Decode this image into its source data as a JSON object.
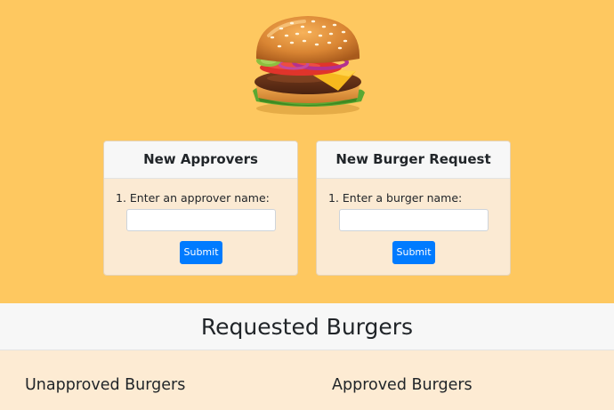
{
  "hero": {
    "image_icon": "burger-icon"
  },
  "forms": {
    "approvers": {
      "title": "New Approvers",
      "label": "1. Enter an approver name:",
      "input_value": "",
      "submit_label": "Submit"
    },
    "burger_request": {
      "title": "New Burger Request",
      "label": "1. Enter a burger name:",
      "input_value": "",
      "submit_label": "Submit"
    }
  },
  "requested": {
    "title": "Requested Burgers",
    "unapproved_title": "Unapproved Burgers",
    "approved_title": "Approved Burgers"
  },
  "colors": {
    "hero_background": "#fec860",
    "lower_background": "#fdebd3",
    "button": "#007bff"
  }
}
